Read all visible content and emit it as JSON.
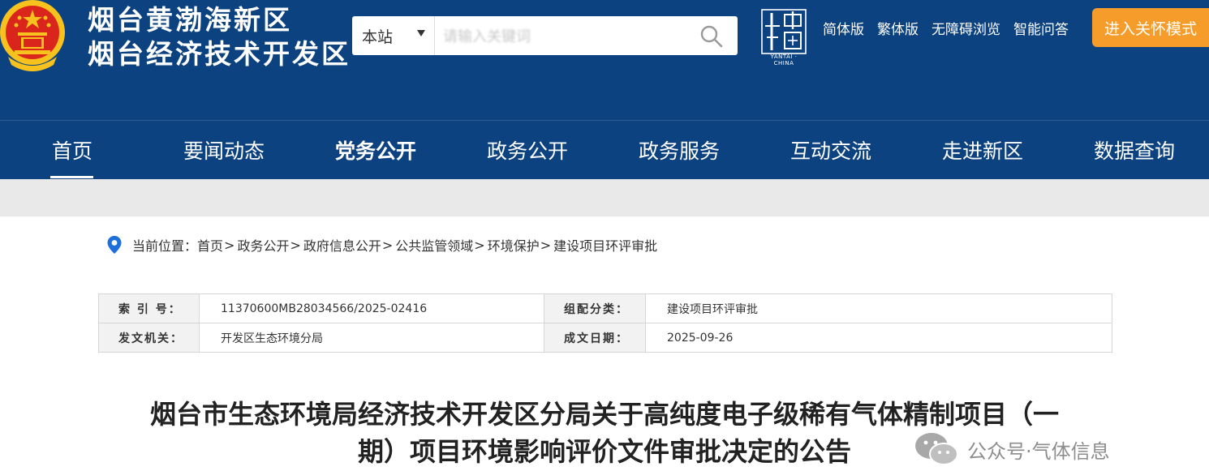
{
  "header": {
    "title_line1": "烟台黄渤海新区",
    "title_line2": "烟台经济技术开发区",
    "search": {
      "scope": "本站",
      "value": "请输入关键词"
    },
    "yantai_logo_caption": "YANTAI · CHINA",
    "links": [
      "简体版",
      "繁体版",
      "无障碍浏览",
      "智能问答"
    ],
    "care_mode": "进入关怀模式"
  },
  "nav": {
    "items": [
      {
        "label": "首页"
      },
      {
        "label": "要闻动态"
      },
      {
        "label": "党务公开"
      },
      {
        "label": "政务公开"
      },
      {
        "label": "政务服务"
      },
      {
        "label": "互动交流"
      },
      {
        "label": "走进新区"
      },
      {
        "label": "数据查询"
      }
    ]
  },
  "breadcrumb": {
    "prefix": "当前位置：",
    "items": [
      "首页",
      "政务公开",
      "政府信息公开",
      "公共监管领域",
      "环境保护",
      "建设项目环评审批"
    ],
    "separator": ">"
  },
  "info": {
    "index_label": "索 引 号：",
    "index_value": "11370600MB28034566/2025-02416",
    "category_label": "组配分类：",
    "category_value": "建设项目环评审批",
    "issuer_label": "发文机关：",
    "issuer_value": "开发区生态环境分局",
    "date_label": "成文日期：",
    "date_value": "2025-09-26"
  },
  "article": {
    "title_line1": "烟台市生态环境局经济技术开发区分局关于高纯度电子级稀有气体精制项目（一",
    "title_line2": "期）项目环境影响评价文件审批决定的公告"
  },
  "watermark": {
    "text": "公众号·气体信息"
  },
  "colors": {
    "header_bg": "#0d4280",
    "care_button": "#f59c2a",
    "pin": "#1e6fd9"
  }
}
